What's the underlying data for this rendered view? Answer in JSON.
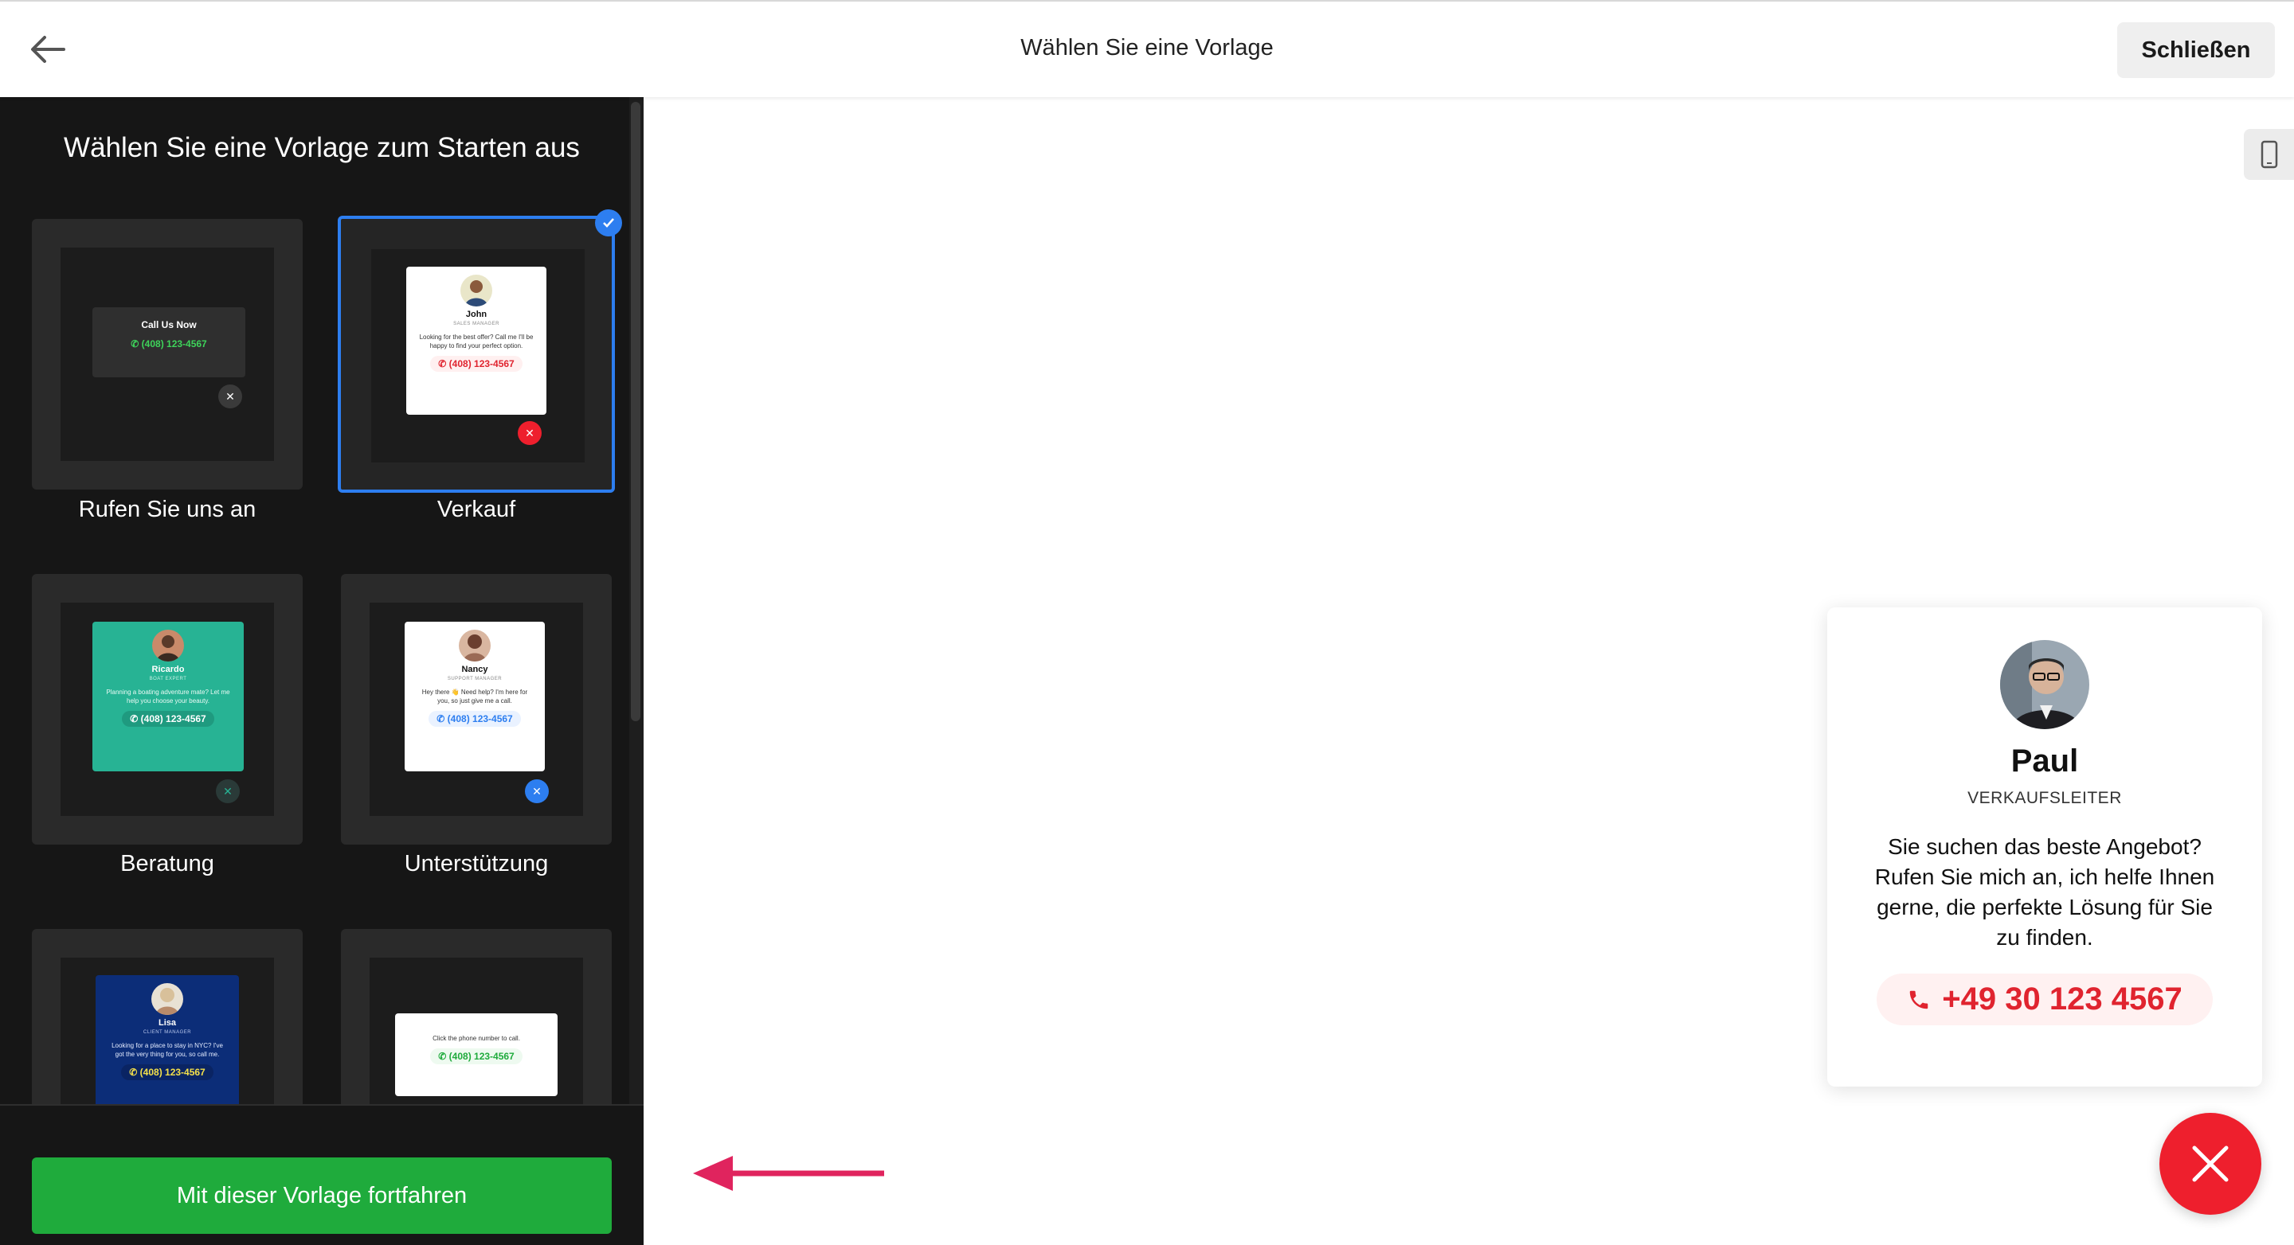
{
  "header": {
    "title": "Wählen Sie eine Vorlage",
    "close_label": "Schließen"
  },
  "sidebar": {
    "heading": "Wählen Sie eine Vorlage zum Starten aus",
    "templates": [
      {
        "label": "Rufen Sie uns an",
        "selected": false,
        "preview": {
          "title": "Call Us Now",
          "phone": "(408) 123-4567"
        }
      },
      {
        "label": "Verkauf",
        "selected": true,
        "preview": {
          "name": "John",
          "role": "SALES MANAGER",
          "text": "Looking for the best offer? Call me I'll be happy to find your perfect option.",
          "phone": "(408) 123-4567"
        }
      },
      {
        "label": "Beratung",
        "selected": false,
        "preview": {
          "name": "Ricardo",
          "role": "BOAT EXPERT",
          "text": "Planning a boating adventure mate? Let me help you choose your beauty.",
          "phone": "(408) 123-4567"
        }
      },
      {
        "label": "Unterstützung",
        "selected": false,
        "preview": {
          "name": "Nancy",
          "role": "SUPPORT MANAGER",
          "text": "Hey there 👋 Need help? I'm here for you, so just give me a call.",
          "phone": "(408) 123-4567"
        }
      },
      {
        "label": "",
        "selected": false,
        "preview": {
          "name": "Lisa",
          "role": "CLIENT MANAGER",
          "text": "Looking for a place to stay in NYC? I've got the very thing for you, so call me.",
          "phone": "(408) 123-4567"
        }
      },
      {
        "label": "",
        "selected": false,
        "preview": {
          "text": "Click the phone number to call.",
          "phone": "(408) 123-4567"
        }
      }
    ],
    "continue_label": "Mit dieser Vorlage fortfahren"
  },
  "preview_widget": {
    "name": "Paul",
    "role": "VERKAUFSLEITER",
    "message": "Sie suchen das beste Angebot? Rufen Sie mich an, ich helfe Ihnen gerne, die perfekte Lösung für Sie zu finden.",
    "phone": "+49 30 123 4567"
  },
  "colors": {
    "accent_blue": "#2d7ef0",
    "continue_green": "#1fab3c",
    "phone_red": "#e0242f",
    "fab_red": "#ee1f2d",
    "arrow_pink": "#e0245e"
  },
  "icons": {
    "back": "arrow-left-icon",
    "device": "mobile-phone-icon",
    "fab": "close-icon",
    "phone": "phone-icon"
  }
}
